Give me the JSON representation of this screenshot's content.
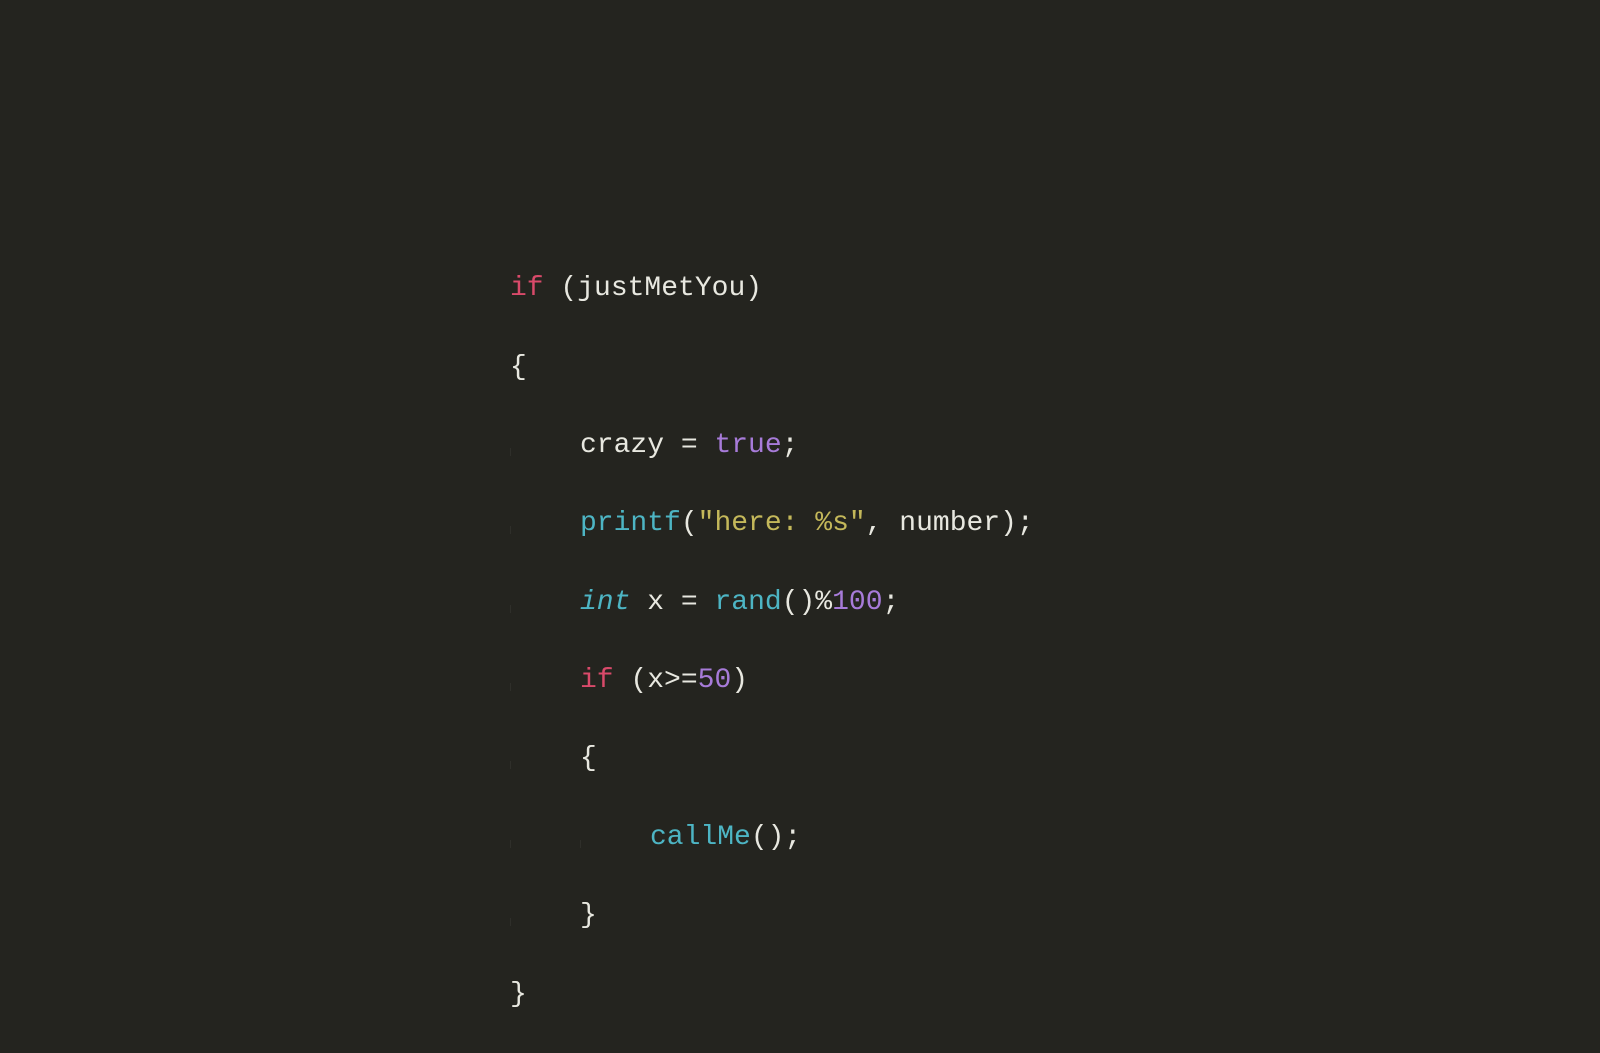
{
  "code": {
    "line1": {
      "if": "if",
      "sp1": " (",
      "cond": "justMetYou",
      "sp2": ")"
    },
    "line2": {
      "brace": "{"
    },
    "line3": {
      "var": "crazy",
      "sp1": " = ",
      "val": "true",
      "semi": ";"
    },
    "line4": {
      "fn": "printf",
      "sp1": "(",
      "str": "\"here: %s\"",
      "sp2": ", ",
      "arg": "number",
      "sp3": ");"
    },
    "line5": {
      "type": "int",
      "sp1": " ",
      "var": "x",
      "sp2": " = ",
      "fn": "rand",
      "sp3": "()%",
      "num": "100",
      "semi": ";"
    },
    "line6": {
      "if": "if",
      "sp1": " (",
      "var": "x",
      "op": ">=",
      "num": "50",
      "sp2": ")"
    },
    "line7": {
      "brace": "{"
    },
    "line8": {
      "fn": "callMe",
      "sp1": "();"
    },
    "line9": {
      "brace": "}"
    },
    "line10": {
      "brace": "}"
    }
  }
}
